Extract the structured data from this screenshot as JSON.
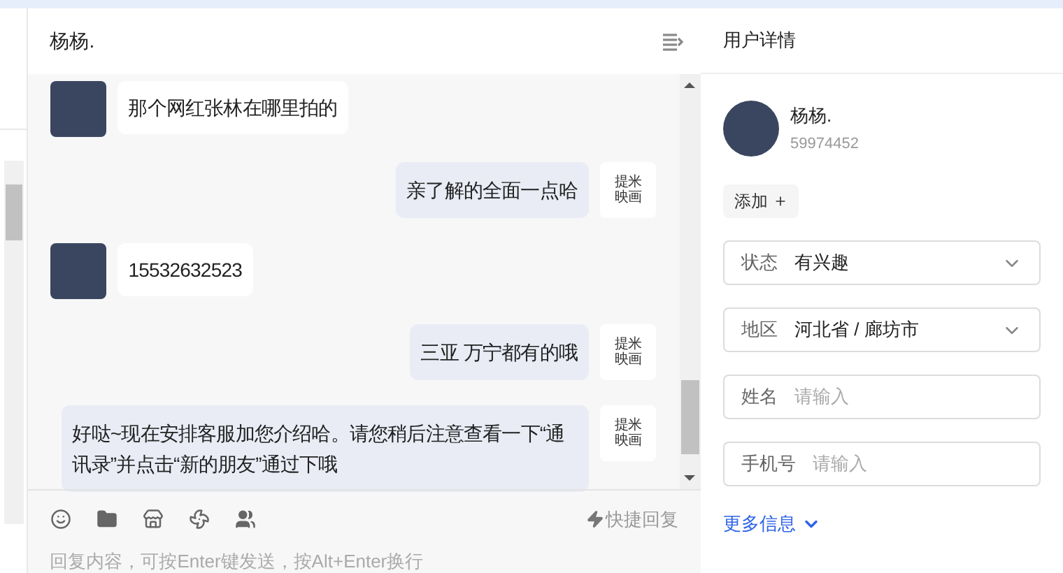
{
  "chat": {
    "title": "杨杨.",
    "messages": [
      {
        "kind": "incoming",
        "text": "那个网红张林在哪里拍的"
      },
      {
        "kind": "outgoing",
        "text": "亲了解的全面一点哈",
        "logo": "提米映画"
      },
      {
        "kind": "incoming",
        "text": "15532632523"
      },
      {
        "kind": "outgoing",
        "text": "三亚 万宁都有的哦",
        "logo": "提米映画"
      },
      {
        "kind": "outgoing",
        "text": "好哒~现在安排客服加您介绍哈。请您稍后注意查看一下“通讯录”并点击“新的朋友”通过下哦",
        "logo": "提米映画"
      }
    ],
    "quick_reply": "快捷回复",
    "input": {
      "placeholder": "回复内容，可按Enter键发送，按Alt+Enter换行"
    }
  },
  "details": {
    "title": "用户详情",
    "name": "杨杨.",
    "id": "59974452",
    "add_button": "添加",
    "fields": [
      {
        "kind": "select",
        "label": "状态",
        "value": "有兴趣"
      },
      {
        "kind": "select",
        "label": "地区",
        "value": "河北省 / 廊坊市"
      },
      {
        "kind": "input",
        "label": "姓名",
        "placeholder": "请输入"
      },
      {
        "kind": "input",
        "label": "手机号",
        "placeholder": "请输入"
      }
    ],
    "more_link": "更多信息"
  }
}
